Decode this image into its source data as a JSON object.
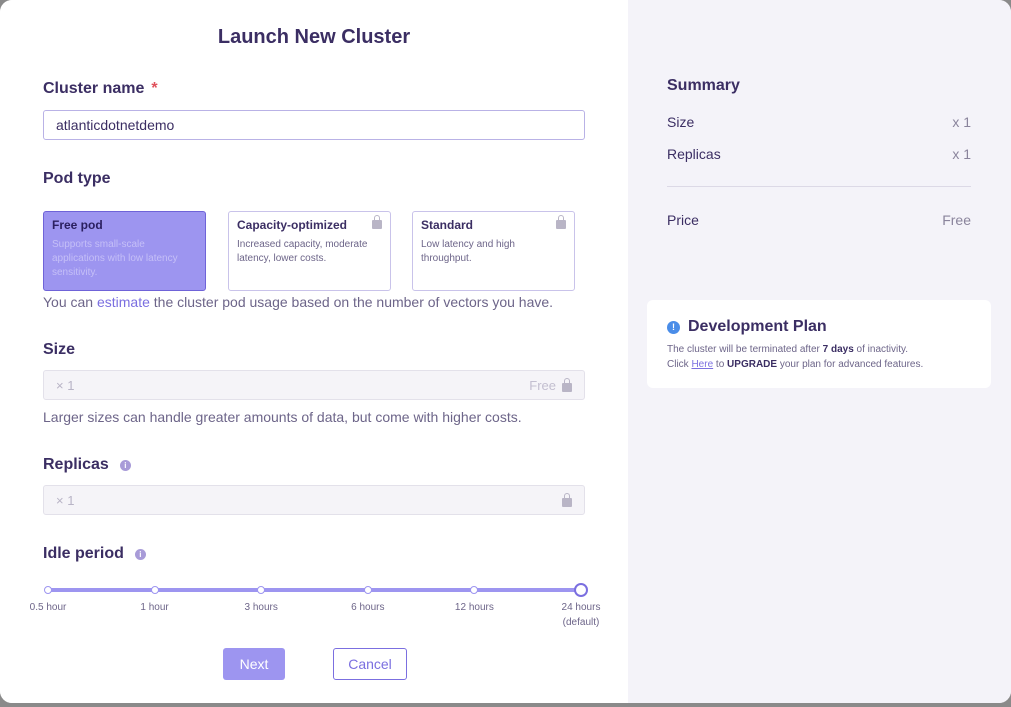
{
  "modal": {
    "title": "Launch New Cluster"
  },
  "cluster_name": {
    "label": "Cluster name",
    "required_mark": "*",
    "value": "atlanticdotnetdemo"
  },
  "pod_type": {
    "label": "Pod type",
    "options": [
      {
        "title": "Free pod",
        "desc": "Supports small-scale applications with low latency sensitivity.",
        "selected": true,
        "locked": false
      },
      {
        "title": "Capacity-optimized",
        "desc": "Increased capacity, moderate latency, lower costs.",
        "selected": false,
        "locked": true
      },
      {
        "title": "Standard",
        "desc": "Low latency and high throughput.",
        "selected": false,
        "locked": true
      }
    ],
    "helper_prefix": "You can ",
    "helper_link": "estimate",
    "helper_suffix": " the cluster pod usage based on the number of vectors you have."
  },
  "size": {
    "label": "Size",
    "value": "× 1",
    "price": "Free",
    "helper": "Larger sizes can handle greater amounts of data, but come with higher costs."
  },
  "replicas": {
    "label": "Replicas",
    "info": "i",
    "value": "× 1"
  },
  "idle_period": {
    "label": "Idle period",
    "info": "i",
    "stops": [
      {
        "label": "0.5 hour",
        "sub": ""
      },
      {
        "label": "1 hour",
        "sub": ""
      },
      {
        "label": "3 hours",
        "sub": ""
      },
      {
        "label": "6 hours",
        "sub": ""
      },
      {
        "label": "12 hours",
        "sub": ""
      },
      {
        "label": "24 hours",
        "sub": "(default)"
      }
    ],
    "selected_index": 5
  },
  "buttons": {
    "next": "Next",
    "cancel": "Cancel"
  },
  "summary": {
    "title": "Summary",
    "size_label": "Size",
    "size_value": "x 1",
    "replicas_label": "Replicas",
    "replicas_value": "x 1",
    "price_label": "Price",
    "price_value": "Free"
  },
  "plan": {
    "icon": "!",
    "title": "Development Plan",
    "line1_prefix": "The cluster will be terminated after ",
    "line1_bold": "7 days",
    "line1_suffix": " of inactivity.",
    "line2_prefix": "Click ",
    "line2_link": "Here",
    "line2_mid": " to ",
    "line2_bold": "UPGRADE",
    "line2_suffix": " your plan for advanced features."
  },
  "colors": {
    "accent": "#7b6fe0",
    "accent_light": "#9d95f0",
    "text": "#3b2e63",
    "required": "#e0525c",
    "info": "#4a8de8"
  }
}
